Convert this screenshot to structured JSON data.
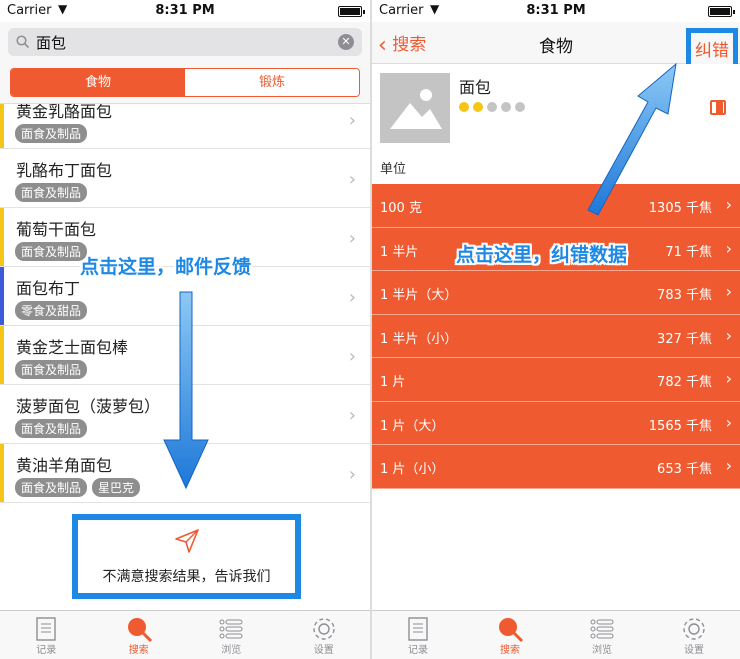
{
  "left": {
    "status": {
      "carrier": "Carrier",
      "time": "8:31 PM"
    },
    "search": {
      "query": "面包"
    },
    "segments": [
      "食物",
      "锻炼"
    ],
    "rows": [
      {
        "name": "黄金乳酪面包",
        "tags": [
          "面食及制品"
        ],
        "bar_color": "#f5c518"
      },
      {
        "name": "乳酪布丁面包",
        "tags": [
          "面食及制品"
        ],
        "bar_color": ""
      },
      {
        "name": "葡萄干面包",
        "tags": [
          "面食及制品"
        ],
        "bar_color": "#f5c518"
      },
      {
        "name": "面包布丁",
        "tags": [
          "零食及甜品"
        ],
        "bar_color": "#3b5bdb"
      },
      {
        "name": "黄金芝士面包棒",
        "tags": [
          "面食及制品"
        ],
        "bar_color": "#f5c518"
      },
      {
        "name": "菠萝面包（菠萝包）",
        "tags": [
          "面食及制品"
        ],
        "bar_color": ""
      },
      {
        "name": "黄油羊角面包",
        "tags": [
          "面食及制品",
          "星巴克"
        ],
        "bar_color": "#f5c518"
      }
    ],
    "feedback_text": "不满意搜索结果，告诉我们",
    "annotation": "点击这里，邮件反馈"
  },
  "right": {
    "status": {
      "carrier": "Carrier",
      "time": "8:31 PM"
    },
    "nav": {
      "back": "搜索",
      "title": "食物",
      "report": "纠错"
    },
    "food": {
      "name": "面包",
      "rating": 2,
      "rating_max": 5
    },
    "unit_label": "单位",
    "units": [
      {
        "name": "100 克",
        "value": "1305 千焦"
      },
      {
        "name": "1 半片",
        "value": "71 千焦"
      },
      {
        "name": "1 半片（大）",
        "value": "783 千焦"
      },
      {
        "name": "1 半片（小）",
        "value": "327 千焦"
      },
      {
        "name": "1 片",
        "value": "782 千焦"
      },
      {
        "name": "1 片（大）",
        "value": "1565 千焦"
      },
      {
        "name": "1 片（小）",
        "value": "653 千焦"
      }
    ],
    "annotation": "点击这里，纠错数据"
  },
  "tabbar": [
    "记录",
    "搜索",
    "浏览",
    "设置"
  ],
  "colors": {
    "accent": "#ef5a31",
    "highlight": "#1e88e5",
    "tag": "#8e8e8e"
  }
}
